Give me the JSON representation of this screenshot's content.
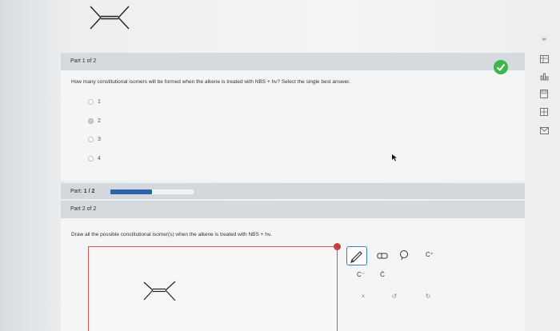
{
  "part1": {
    "header": "Part 1 of 2",
    "question": "How many constitutional isomers will be formed when the alkene is treated with NBS + hν? Select the single best answer.",
    "options": [
      {
        "label": "1",
        "selected": false
      },
      {
        "label": "2",
        "selected": true
      },
      {
        "label": "3",
        "selected": false
      },
      {
        "label": "4",
        "selected": false
      }
    ],
    "status": "correct"
  },
  "progress": {
    "label_prefix": "Part:",
    "label_value": "1 / 2",
    "fraction": 0.5
  },
  "part2": {
    "header": "Part 2 of 2",
    "question": "Draw all the possible constitutional isomer(s) when the alkene is treated with NBS + hν."
  },
  "toolbar": {
    "pencil": "pencil-icon",
    "eraser": "eraser-icon",
    "lasso": "lasso-icon",
    "charge_plus": "C⁺",
    "charge_minus": "C⁻",
    "radical": "C̈",
    "clear": "×",
    "undo": "↺",
    "redo": "↻"
  },
  "sidebar_icons": [
    "infinity-icon",
    "periodic-table-icon",
    "bar-chart-icon",
    "calculator-icon",
    "grid-icon",
    "mail-icon"
  ]
}
